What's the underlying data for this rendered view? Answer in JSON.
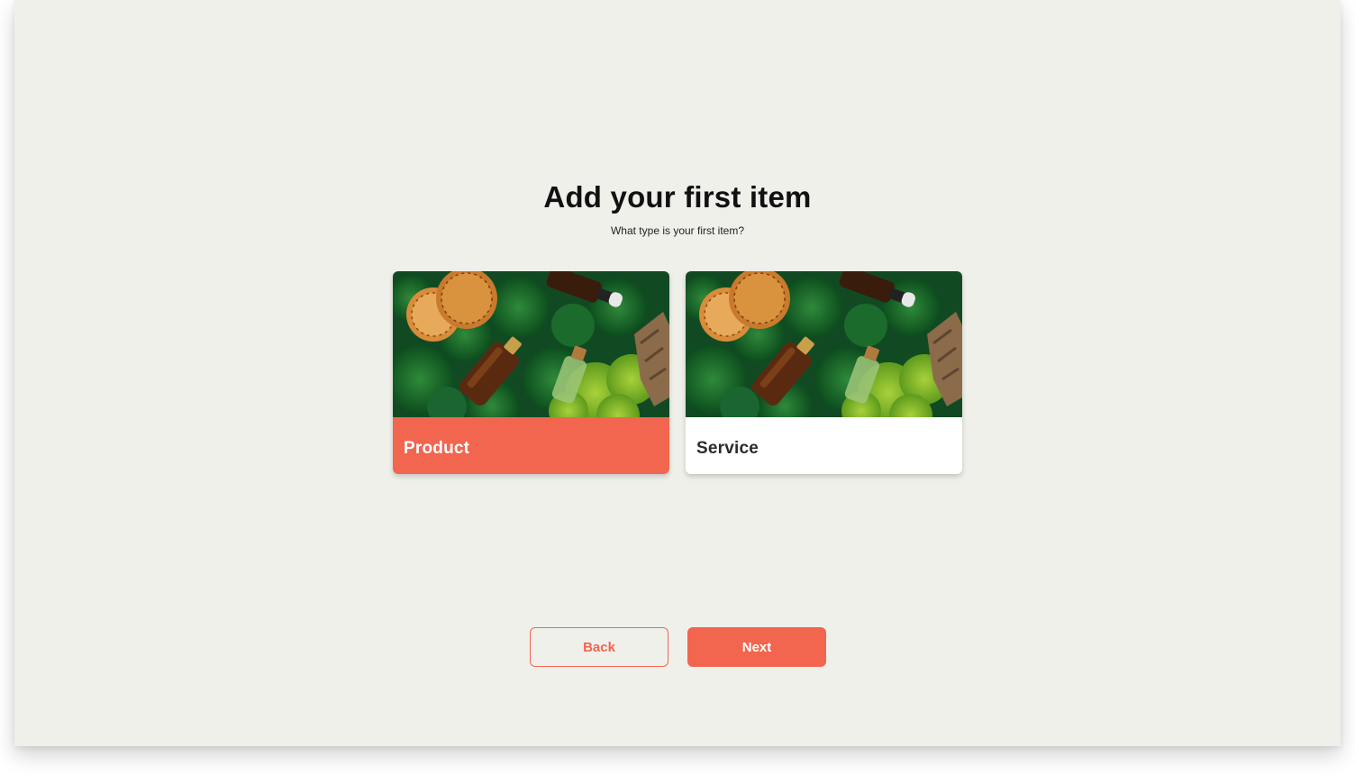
{
  "colors": {
    "accent": "#f2654f",
    "page_background": "#f0f0eb"
  },
  "header": {
    "title": "Add your first item",
    "subtitle": "What type is your first item?"
  },
  "options": [
    {
      "label": "Product",
      "image": "botanical-oils-photo",
      "selected": true
    },
    {
      "label": "Service",
      "image": "botanical-oils-photo",
      "selected": false
    }
  ],
  "footer": {
    "back_label": "Back",
    "next_label": "Next"
  }
}
